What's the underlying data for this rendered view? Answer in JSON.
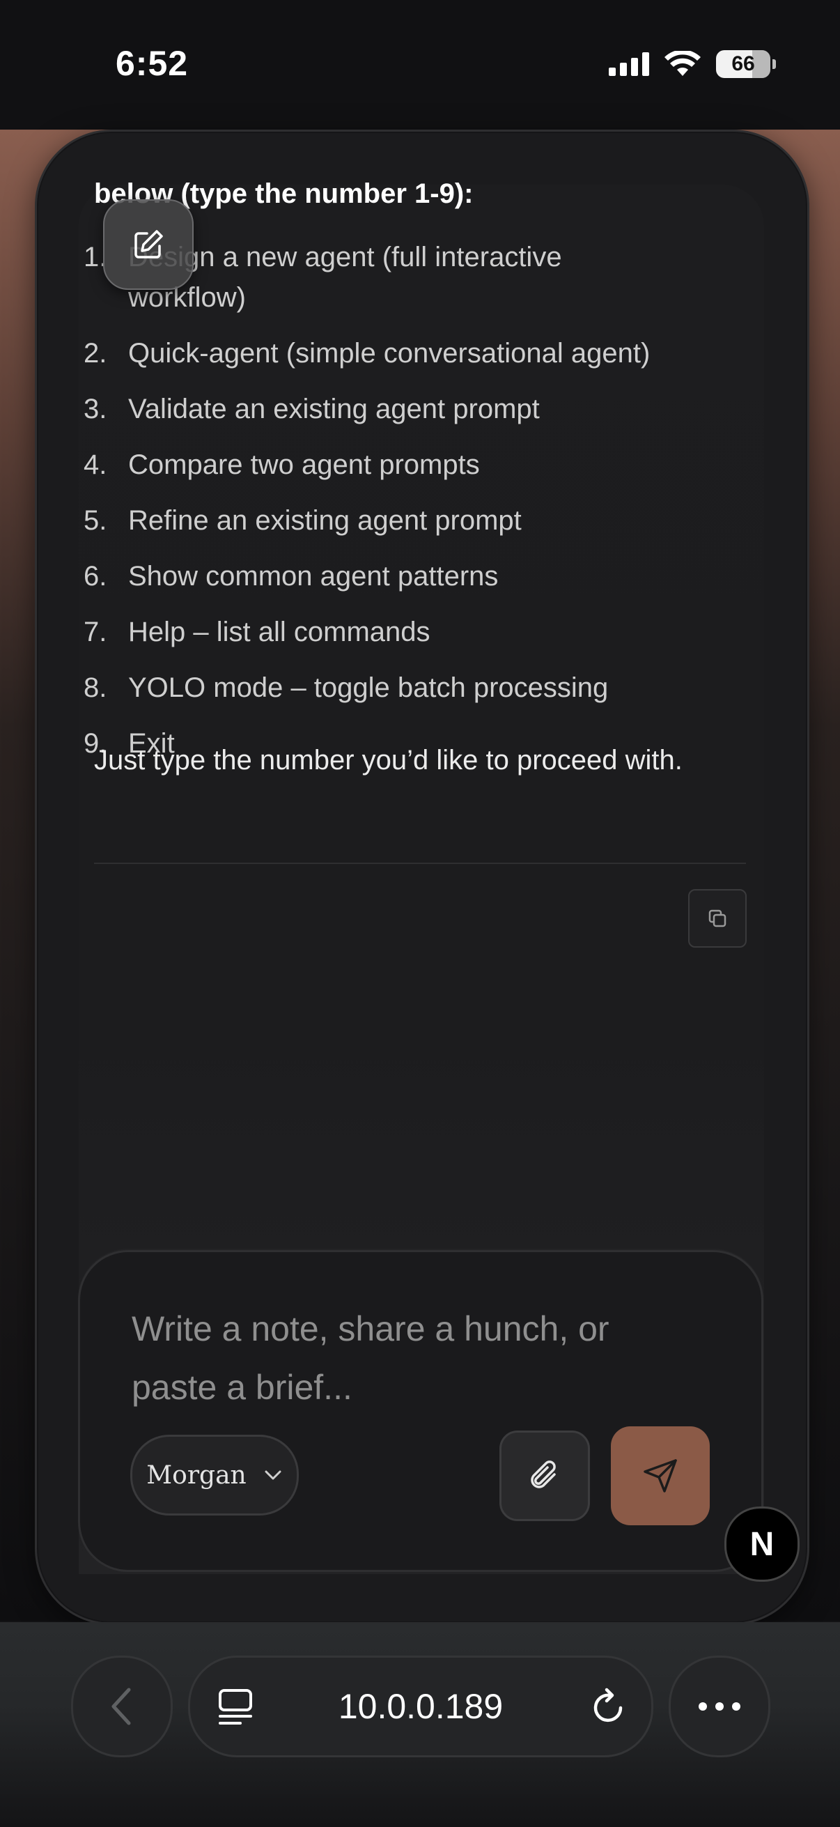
{
  "status_bar": {
    "time": "6:52",
    "battery": "66"
  },
  "message": {
    "heading": "below (type the number 1-9):",
    "options": [
      {
        "num": "1.",
        "text": "Design a new agent (full interactive workflow)"
      },
      {
        "num": "2.",
        "text": "Quick-agent (simple conversational agent)"
      },
      {
        "num": "3.",
        "text": "Validate an existing agent prompt"
      },
      {
        "num": "4.",
        "text": "Compare two agent prompts"
      },
      {
        "num": "5.",
        "text": "Refine an existing agent prompt"
      },
      {
        "num": "6.",
        "text": "Show common agent patterns"
      },
      {
        "num": "7.",
        "text": "Help – list all commands"
      },
      {
        "num": "8.",
        "text": "YOLO mode – toggle batch processing"
      },
      {
        "num": "9.",
        "text": "Exit"
      }
    ],
    "outro": "Just type the number you’d like to proceed with."
  },
  "composer": {
    "placeholder": "Write a note, share a hunch, or paste a brief...",
    "model": "Morgan"
  },
  "badge": "N",
  "browser": {
    "url": "10.0.0.189"
  },
  "colors": {
    "send_accent": "#8b5a47",
    "background_warm": "#8a5e4f"
  }
}
